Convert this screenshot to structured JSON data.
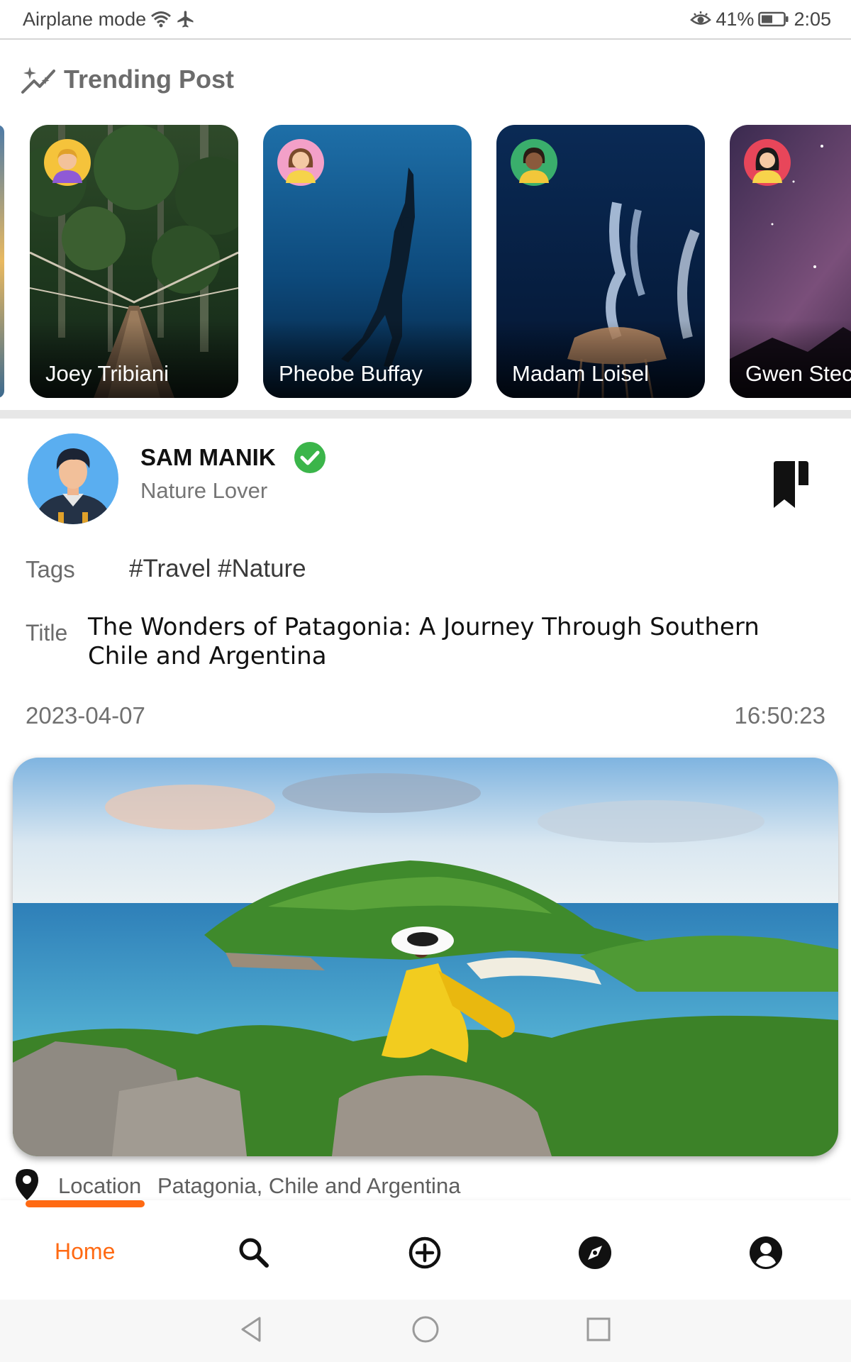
{
  "status_bar": {
    "left_text": "Airplane mode",
    "battery_percent": "41%",
    "time": "2:05"
  },
  "trending": {
    "title": "Trending Post",
    "stories": [
      {
        "name": "Joey Tribiani",
        "avatar_bg": "#f5c33b"
      },
      {
        "name": "Pheobe Buffay",
        "avatar_bg": "#f3a0c8"
      },
      {
        "name": "Madam Loisel",
        "avatar_bg": "#3aae6c"
      },
      {
        "name": "Gwen Stec",
        "avatar_bg": "#e8465a"
      }
    ]
  },
  "post": {
    "author": "SAM MANIK",
    "role": "Nature Lover",
    "tags_label": "Tags",
    "tags": "#Travel #Nature",
    "title_label": "Title",
    "title": "The Wonders of Patagonia: A Journey Through Southern Chile and Argentina",
    "date": "2023-04-07",
    "time": "16:50:23",
    "location_label": "Location",
    "location": "Patagonia, Chile and Argentina"
  },
  "nav": {
    "home_label": "Home",
    "active_color": "#ff6a13",
    "icons": [
      "search-icon",
      "add-circle-icon",
      "compass-icon",
      "account-icon"
    ]
  },
  "colors": {
    "accent": "#ff6a13",
    "verified": "#3bb54a"
  }
}
